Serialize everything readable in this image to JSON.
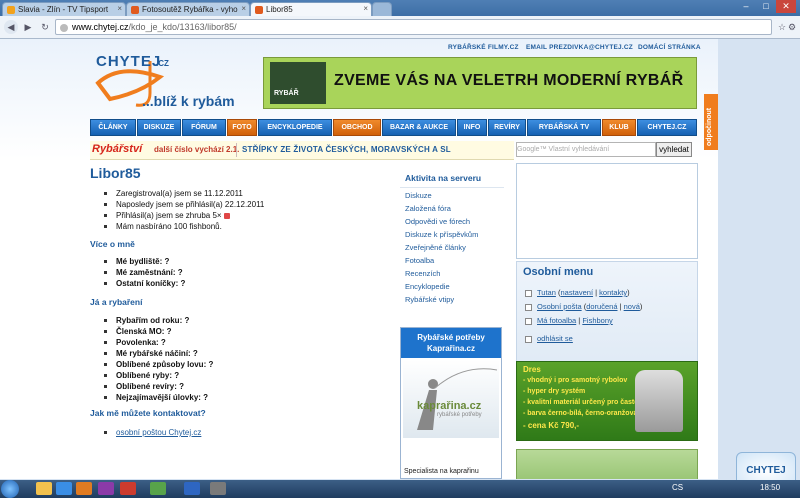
{
  "browser": {
    "tabs": [
      {
        "label": "Slavia - Zlín - TV Tipsport",
        "active": false
      },
      {
        "label": "Fotosoutěž Rybářka - vyho",
        "active": false
      },
      {
        "label": "Libor85",
        "active": true
      }
    ],
    "url_domain": "www.chytej.cz",
    "url_rest": "/kdo_je_kdo/13163/libor85/"
  },
  "header": {
    "toplinks": [
      "RYBÁŘSKÉ FILMY.CZ",
      "EMAIL PREZDIVKA@CHYTEJ.CZ",
      "DOMÁCÍ STRÁNKA"
    ],
    "logo_text": "CHYTEJ",
    "logo_tld": ".CZ",
    "slogan": "...blíž k rybám",
    "banner_text": "ZVEME VÁS NA VELETRH MODERNÍ RYBÁŘ",
    "banner_badge": "RYBÁŘ"
  },
  "nav": [
    {
      "label": "ČLÁNKY",
      "orange": false
    },
    {
      "label": "DISKUZE",
      "orange": false
    },
    {
      "label": "FÓRUM",
      "orange": false
    },
    {
      "label": "FOTO",
      "orange": true
    },
    {
      "label": "ENCYKLOPEDIE",
      "orange": false
    },
    {
      "label": "OBCHOD",
      "orange": true
    },
    {
      "label": "BAZAR & AUKCE",
      "orange": false
    },
    {
      "label": "INFO",
      "orange": false
    },
    {
      "label": "REVÍRY",
      "orange": false
    },
    {
      "label": "RYBÁŘSKÁ TV",
      "orange": false
    },
    {
      "label": "KLUB",
      "orange": true
    },
    {
      "label": "CHYTEJ.CZ",
      "orange": false
    }
  ],
  "ticker": {
    "brand": "Rybářství",
    "subtitle": "další číslo vychází 2.1.",
    "news": "STŘÍPKY ZE ŽIVOTA ČESKÝCH, MORAVSKÝCH A SL"
  },
  "search": {
    "placeholder": "Google™ Vlastní vyhledávání",
    "button": "vyhledat"
  },
  "sidetab": "odpočinout",
  "profile": {
    "name": "Libor85",
    "registered": "Zaregistroval(a) jsem se 11.12.2011",
    "last_login": "Naposledy jsem se přihlásil(a) 22.12.2011",
    "logins": "Přihlásil(a) jsem se zhruba 5×",
    "fishbons": "Mám nasbíráno 100 fishbonů."
  },
  "about": {
    "title": "Více o mně",
    "items": [
      "Mé bydliště: ?",
      "Mé zaměstnání: ?",
      "Ostatní koníčky: ?"
    ]
  },
  "fishing": {
    "title": "Já a rybaření",
    "items": [
      "Rybařím od roku: ?",
      "Členská MO: ?",
      "Povolenka: ?",
      "Mé rybářské náčiní: ?",
      "Oblíbené způsoby lovu: ?",
      "Oblíbené ryby: ?",
      "Oblíbené revíry: ?",
      "Nejzajímavější úlovky: ?"
    ]
  },
  "contact": {
    "title": "Jak mě můžete kontaktovat?",
    "link": "osobní poštou Chytej.cz"
  },
  "activity": {
    "title": "Aktivita na serveru",
    "items": [
      "Diskuze",
      "Založená fóra",
      "Odpovědi ve fórech",
      "Diskuze k příspěvkům",
      "Zveřejněné články",
      "Fotoalba",
      "Recenzích",
      "Encyklopedie",
      "Rybářské vtipy"
    ]
  },
  "kaprarina": {
    "header": "Rybářské potřeby Kaprařina.cz",
    "brand": "kaprařina.cz",
    "sub": "rybářské potřeby",
    "footer": "Specialista na kaprařinu"
  },
  "osobni_menu": {
    "title": "Osobní menu",
    "user": "Tutan",
    "settings": "nastavení",
    "contacts": "kontakty",
    "mail": "Osobní pošta",
    "delivered": "doručená",
    "new": "nová",
    "album": "Má fotoalba",
    "fishbony": "Fishbony",
    "logout": "odhlásit se"
  },
  "dres": {
    "title": "Dres",
    "lines": [
      "- vhodný i pro samotný rybolov",
      "- hyper dry systém",
      "- kvalitní materiál určený pro časté praní",
      "- barva černo-bílá, černo-oranžová",
      "- cena Kč 790,-"
    ]
  },
  "taskbar": {
    "lang": "CS",
    "time": "18:50"
  },
  "badge": "CHYTEJ"
}
